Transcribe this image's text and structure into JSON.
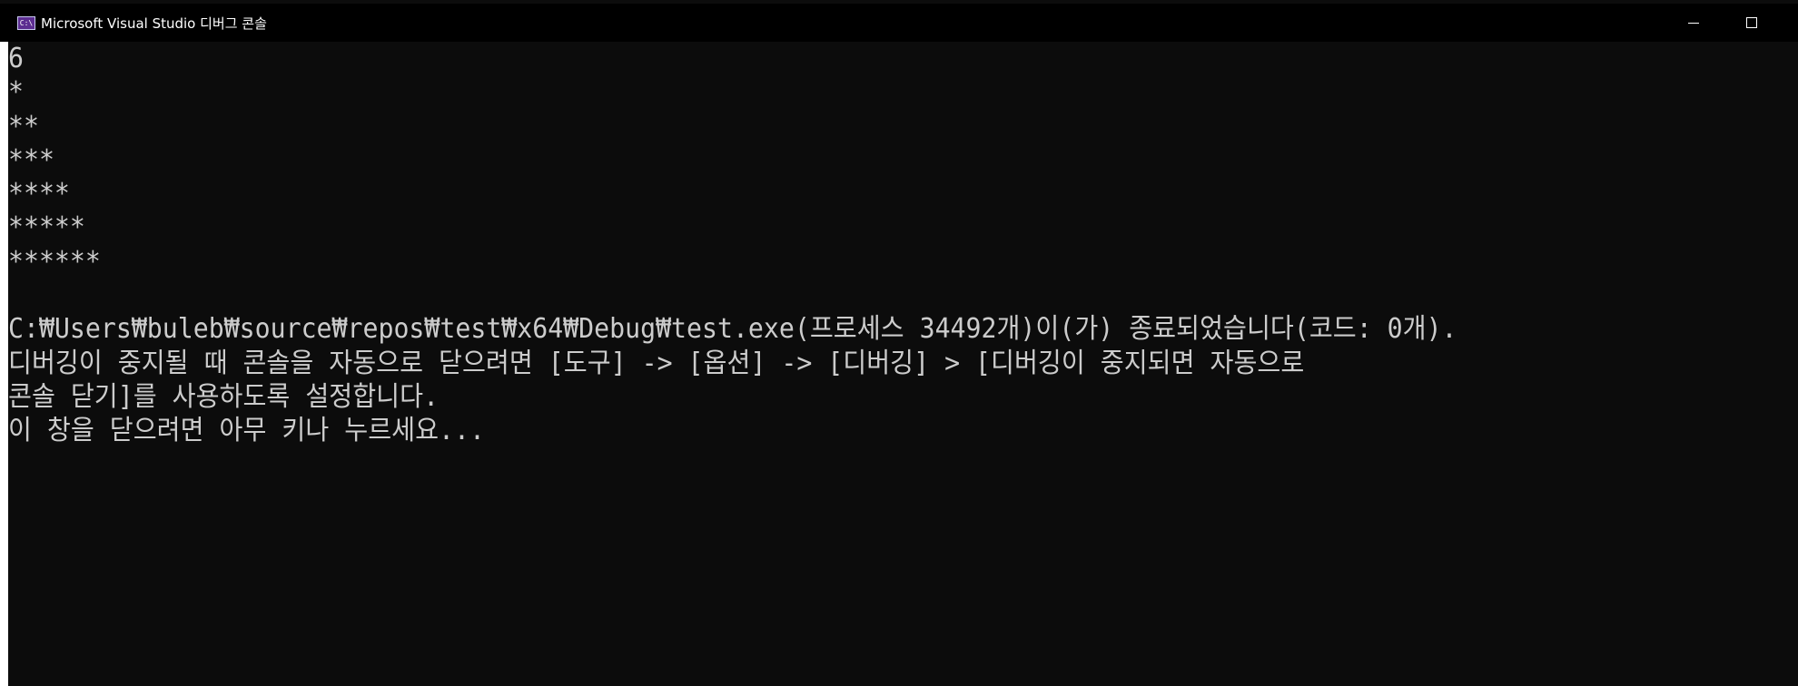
{
  "window": {
    "title": "Microsoft Visual Studio 디버그 콘솔",
    "app_icon_glyph": "C:\\",
    "colors": {
      "titlebar_bg": "#000000",
      "console_bg": "#0c0c0c",
      "console_text": "#cccccc",
      "icon_bg": "#5c2d91"
    }
  },
  "console": {
    "lines": [
      "6",
      "*",
      "**",
      "***",
      "****",
      "*****",
      "******",
      "",
      "C:₩Users₩buleb₩source₩repos₩test₩x64₩Debug₩test.exe(프로세스 34492개)이(가) 종료되었습니다(코드: 0개).",
      "디버깅이 중지될 때 콘솔을 자동으로 닫으려면 [도구] -> [옵션] -> [디버깅] > [디버깅이 중지되면 자동으로",
      "콘솔 닫기]를 사용하도록 설정합니다.",
      "이 창을 닫으려면 아무 키나 누르세요..."
    ]
  }
}
